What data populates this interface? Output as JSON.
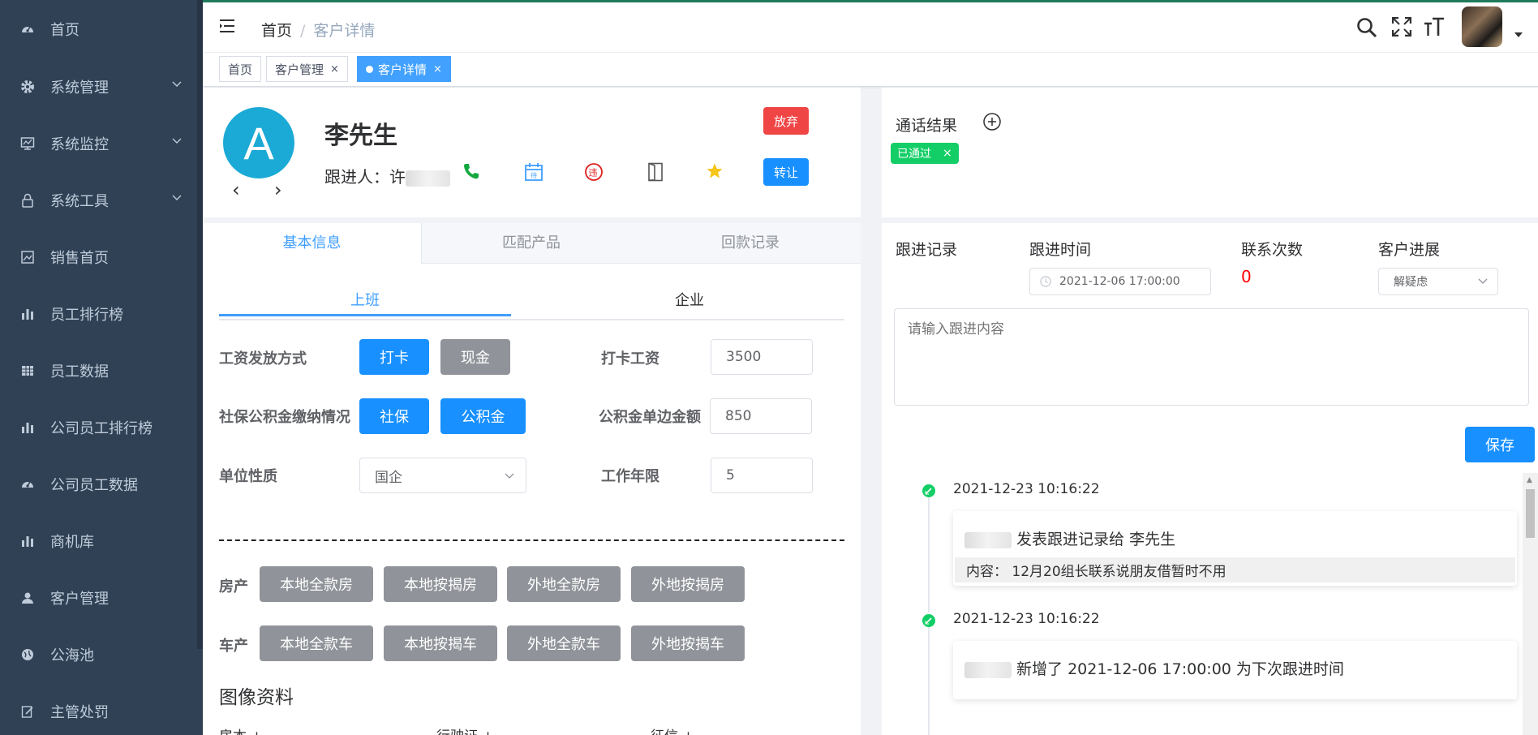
{
  "sidebar": {
    "items": [
      {
        "label": "首页",
        "icon": "dashboard-icon",
        "has_submenu": false
      },
      {
        "label": "系统管理",
        "icon": "gear-icon",
        "has_submenu": true
      },
      {
        "label": "系统监控",
        "icon": "monitor-icon",
        "has_submenu": true
      },
      {
        "label": "系统工具",
        "icon": "lock-icon",
        "has_submenu": true
      },
      {
        "label": "销售首页",
        "icon": "image-icon",
        "has_submenu": false
      },
      {
        "label": "员工排行榜",
        "icon": "bar-chart-icon",
        "has_submenu": false
      },
      {
        "label": "员工数据",
        "icon": "table-icon",
        "has_submenu": false
      },
      {
        "label": "公司员工排行榜",
        "icon": "bar-chart-icon",
        "has_submenu": false
      },
      {
        "label": "公司员工数据",
        "icon": "dashboard-icon",
        "has_submenu": false
      },
      {
        "label": "商机库",
        "icon": "bar-chart-icon",
        "has_submenu": false
      },
      {
        "label": "客户管理",
        "icon": "user-icon",
        "has_submenu": false
      },
      {
        "label": "公海池",
        "icon": "globe-icon",
        "has_submenu": false
      },
      {
        "label": "主管处罚",
        "icon": "edit-icon",
        "has_submenu": false
      }
    ]
  },
  "navbar": {
    "breadcrumb": [
      "首页",
      "客户详情"
    ],
    "breadcrumb_sep": "/"
  },
  "tags": [
    {
      "label": "首页",
      "closable": false,
      "active": false
    },
    {
      "label": "客户管理",
      "closable": true,
      "active": false
    },
    {
      "label": "客户详情",
      "closable": true,
      "active": true
    }
  ],
  "customer": {
    "avatar_letter": "A",
    "name": "李先生",
    "follower_label": "跟进人：",
    "follower_name_visible": "许",
    "abandon_label": "放弃",
    "transfer_label": "转让",
    "prev": "‹",
    "next": "›"
  },
  "tabs": {
    "main": [
      "基本信息",
      "匹配产品",
      "回款记录"
    ],
    "active_main": 0,
    "sub": [
      "上班",
      "企业"
    ],
    "active_sub": 0
  },
  "form": {
    "salary_method": {
      "label": "工资发放方式",
      "options": [
        "打卡",
        "现金"
      ],
      "selected": "打卡"
    },
    "salary_amount": {
      "label": "打卡工资",
      "value": "3500"
    },
    "social": {
      "label": "社保公积金缴纳情况",
      "options": [
        "社保",
        "公积金"
      ],
      "selected": [
        "社保",
        "公积金"
      ]
    },
    "fund_amount": {
      "label": "公积金单边金额",
      "value": "850"
    },
    "unit_type": {
      "label": "单位性质",
      "value": "国企"
    },
    "work_years": {
      "label": "工作年限",
      "value": "5"
    },
    "house": {
      "label": "房产",
      "options": [
        "本地全款房",
        "本地按揭房",
        "外地全款房",
        "外地按揭房"
      ]
    },
    "car": {
      "label": "车产",
      "options": [
        "本地全款车",
        "本地按揭车",
        "外地全款车",
        "外地按揭车"
      ]
    },
    "image_title": "图像资料",
    "image_subs": [
      "房本 +",
      "行驶证 +",
      "征信 +"
    ]
  },
  "call_result": {
    "title": "通话结果",
    "tag": "已通过",
    "tag_close": "×"
  },
  "follow": {
    "headers": [
      "跟进记录",
      "跟进时间",
      "联系次数",
      "客户进展"
    ],
    "time_value": "2021-12-06 17:00:00",
    "count": "0",
    "progress": "解疑虑",
    "placeholder": "请输入跟进内容",
    "save_label": "保存",
    "timeline": [
      {
        "time": "2021-12-23 10:16:22",
        "text": "发表跟进记录给 李先生",
        "content": "内容： 12月20组长联系说朋友借暂时不用"
      },
      {
        "time": "2021-12-23 10:16:22",
        "text": "新增了 2021-12-06 17:00:00 为下次跟进时间"
      }
    ]
  },
  "colors": {
    "sidebar_bg": "#304156",
    "primary": "#1890ff",
    "danger": "#f56c6c",
    "success": "#13ce66",
    "gray_btn": "#909399"
  }
}
